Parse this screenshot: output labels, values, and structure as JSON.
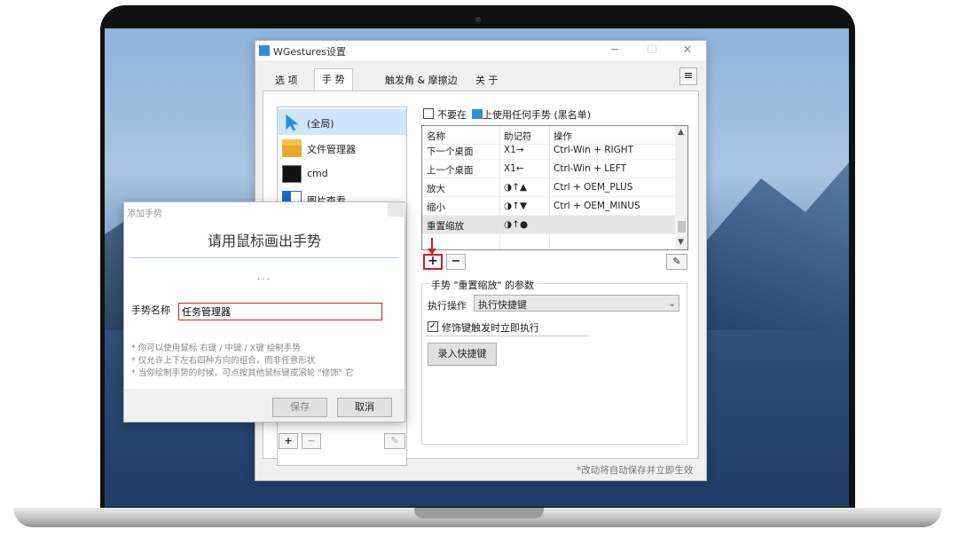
{
  "window": {
    "title": "WGestures设置",
    "minimize": "─",
    "maximize": "☐",
    "close": "✕",
    "menu": "≡"
  },
  "tabs": [
    {
      "label": "选 项"
    },
    {
      "label": "手 势"
    },
    {
      "label": "触发角 & 摩擦边"
    },
    {
      "label": "关 于"
    }
  ],
  "apps": [
    {
      "label": "(全局)",
      "icon": "cursor-icon"
    },
    {
      "label": "文件管理器",
      "icon": "folder-icon"
    },
    {
      "label": "cmd",
      "icon": "terminal-icon"
    },
    {
      "label": "图片查看",
      "icon": "image-viewer-icon"
    }
  ],
  "app_controls": {
    "add": "+",
    "remove": "−",
    "edit": "✎"
  },
  "blacklist": {
    "prefix": "不要在",
    "suffix": "上使用任何手势 (黑名单)"
  },
  "table": {
    "headers": [
      "名称",
      "助记符",
      "操作"
    ],
    "rows": [
      [
        "下一个桌面",
        "X1→",
        "Ctrl-Win + RIGHT"
      ],
      [
        "上一个桌面",
        "X1←",
        "Ctrl-Win + LEFT"
      ],
      [
        "放大",
        "◑↑▲",
        "Ctrl + OEM_PLUS"
      ],
      [
        "缩小",
        "◑↑▼",
        "Ctrl + OEM_MINUS"
      ],
      [
        "重置缩放",
        "◑↑●",
        ""
      ]
    ]
  },
  "gesture_controls": {
    "add": "+",
    "remove": "−",
    "edit": "✎"
  },
  "params": {
    "title": "手势 \"重置缩放\" 的参数",
    "action_label": "执行操作",
    "action_value": "执行快捷键",
    "modifier_check": "修饰键触发时立即执行",
    "record_button": "录入快捷键"
  },
  "footer_note": "*改动将自动保存并立即生效",
  "dialog": {
    "title": "添加手势",
    "heading": "请用鼠标画出手势",
    "dots": "···",
    "name_label": "手势名称",
    "name_value": "任务管理器",
    "tips": [
      "* 你可以使用鼠标 右键 / 中键 / X键 绘制手势",
      "* 仅允许上下左右四种方向的组合，而非任意形状",
      "* 当你绘制手势的时候，可点按其他鼠标键或滚轮 \"修饰\" 它"
    ],
    "save": "保存",
    "cancel": "取消"
  }
}
